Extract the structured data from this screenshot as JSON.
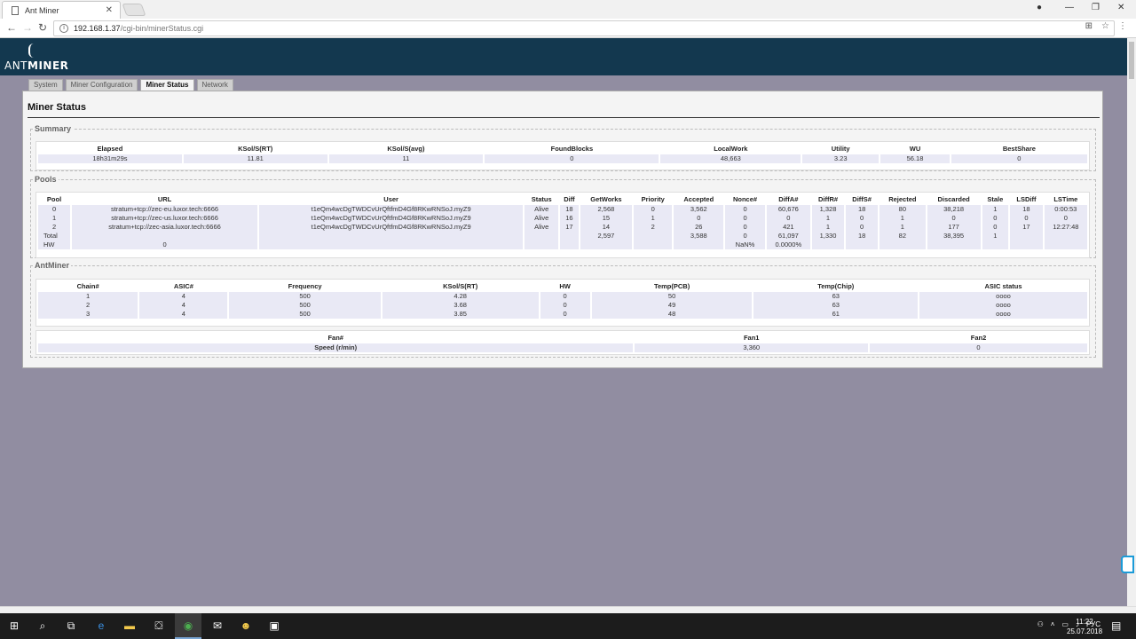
{
  "browser": {
    "tab_title": "Ant Miner",
    "url_host": "192.168.1.37",
    "url_path": "/cgi-bin/minerStatus.cgi"
  },
  "logo": {
    "ant": "ANT",
    "miner": "MINER"
  },
  "nav_tabs": [
    {
      "label": "System",
      "active": false
    },
    {
      "label": "Miner Configuration",
      "active": false
    },
    {
      "label": "Miner Status",
      "active": true
    },
    {
      "label": "Network",
      "active": false
    }
  ],
  "page_title": "Miner Status",
  "summary": {
    "legend": "Summary",
    "headers": [
      "Elapsed",
      "KSol/S(RT)",
      "KSol/S(avg)",
      "FoundBlocks",
      "LocalWork",
      "Utility",
      "WU",
      "BestShare"
    ],
    "row": [
      "18h31m29s",
      "11.81",
      "11",
      "0",
      "48,663",
      "3.23",
      "56.18",
      "0"
    ]
  },
  "pools": {
    "legend": "Pools",
    "headers": [
      "Pool",
      "URL",
      "User",
      "Status",
      "Diff",
      "GetWorks",
      "Priority",
      "Accepted",
      "Nonce#",
      "DiffA#",
      "DiffR#",
      "DiffS#",
      "Rejected",
      "Discarded",
      "Stale",
      "LSDiff",
      "LSTime"
    ],
    "rows": [
      [
        "0",
        "stratum+tcp://zec-eu.luxor.tech:6666",
        "t1eQm4wcDgTWDCvUrQftfmD4Gf8RKwRNSoJ.myZ9",
        "Alive",
        "18",
        "2,568",
        "0",
        "3,562",
        "0",
        "60,676",
        "1,328",
        "18",
        "80",
        "38,218",
        "1",
        "18",
        "0:00:53"
      ],
      [
        "1",
        "stratum+tcp://zec-us.luxor.tech:6666",
        "t1eQm4wcDgTWDCvUrQftfmD4Gf8RKwRNSoJ.myZ9",
        "Alive",
        "16",
        "15",
        "1",
        "0",
        "0",
        "0",
        "1",
        "0",
        "1",
        "0",
        "0",
        "0",
        "0"
      ],
      [
        "2",
        "stratum+tcp://zec-asia.luxor.tech:6666",
        "t1eQm4wcDgTWDCvUrQftfmD4Gf8RKwRNSoJ.myZ9",
        "Alive",
        "17",
        "14",
        "2",
        "26",
        "0",
        "421",
        "1",
        "0",
        "1",
        "177",
        "0",
        "17",
        "12:27:48"
      ],
      [
        "Total",
        "",
        "",
        "",
        "",
        "2,597",
        "",
        "3,588",
        "0",
        "61,097",
        "1,330",
        "18",
        "82",
        "38,395",
        "1",
        "",
        ""
      ]
    ],
    "hw_row": {
      "label": "HW",
      "value": "0",
      "nan": "NaN%",
      "pct": "0.0000%"
    }
  },
  "antminer": {
    "legend": "AntMiner",
    "headers": [
      "Chain#",
      "ASIC#",
      "Frequency",
      "KSol/S(RT)",
      "HW",
      "Temp(PCB)",
      "Temp(Chip)",
      "ASIC status"
    ],
    "rows": [
      [
        "1",
        "4",
        "500",
        "4.28",
        "0",
        "50",
        "63",
        "oooo"
      ],
      [
        "2",
        "4",
        "500",
        "3.68",
        "0",
        "49",
        "63",
        "oooo"
      ],
      [
        "3",
        "4",
        "500",
        "3.85",
        "0",
        "48",
        "61",
        "oooo"
      ]
    ]
  },
  "fans": {
    "headers": [
      "Fan#",
      "Fan1",
      "Fan2"
    ],
    "row": [
      "Speed (r/min)",
      "3,360",
      "0"
    ]
  },
  "taskbar": {
    "lang": "РУС",
    "time": "11:22",
    "date": "25.07.2018"
  }
}
